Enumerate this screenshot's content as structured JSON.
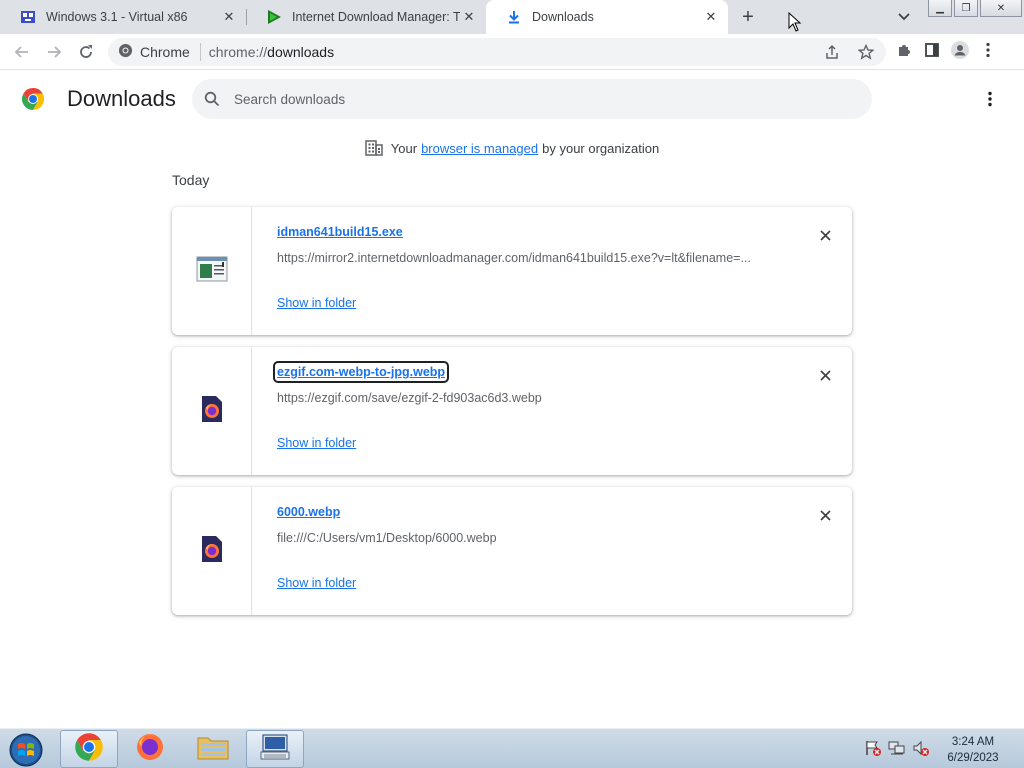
{
  "tabs": [
    {
      "title": "Windows 3.1 - Virtual x86",
      "icon": "pixel-app-icon"
    },
    {
      "title": "Internet Download Manager: The",
      "icon": "play-triangle-icon"
    },
    {
      "title": "Downloads",
      "icon": "download-arrow-icon",
      "active": true
    }
  ],
  "toolbar": {
    "chip_label": "Chrome",
    "url_scheme": "chrome://",
    "url_host": "downloads"
  },
  "page": {
    "title": "Downloads",
    "search_placeholder": "Search downloads",
    "managed_prefix": "Your",
    "managed_link": "browser is managed",
    "managed_suffix": "by your organization",
    "section_date": "Today"
  },
  "downloads": [
    {
      "filename": "idman641build15.exe",
      "url": "https://mirror2.internetdownloadmanager.com/idman641build15.exe?v=lt&filename=...",
      "action": "Show in folder",
      "icon": "exe-window-icon"
    },
    {
      "filename": "ezgif.com-webp-to-jpg.webp",
      "url": "https://ezgif.com/save/ezgif-2-fd903ac6d3.webp",
      "action": "Show in folder",
      "icon": "firefox-file-icon"
    },
    {
      "filename": "6000.webp",
      "url": "file:///C:/Users/vm1/Desktop/6000.webp",
      "action": "Show in folder",
      "icon": "firefox-file-icon"
    }
  ],
  "taskbar": {
    "time": "3:24 AM",
    "date": "6/29/2023"
  },
  "colors": {
    "link": "#1a73e8",
    "tabstrip": "#dee1e6",
    "taskbar": "#b6c9dc"
  }
}
